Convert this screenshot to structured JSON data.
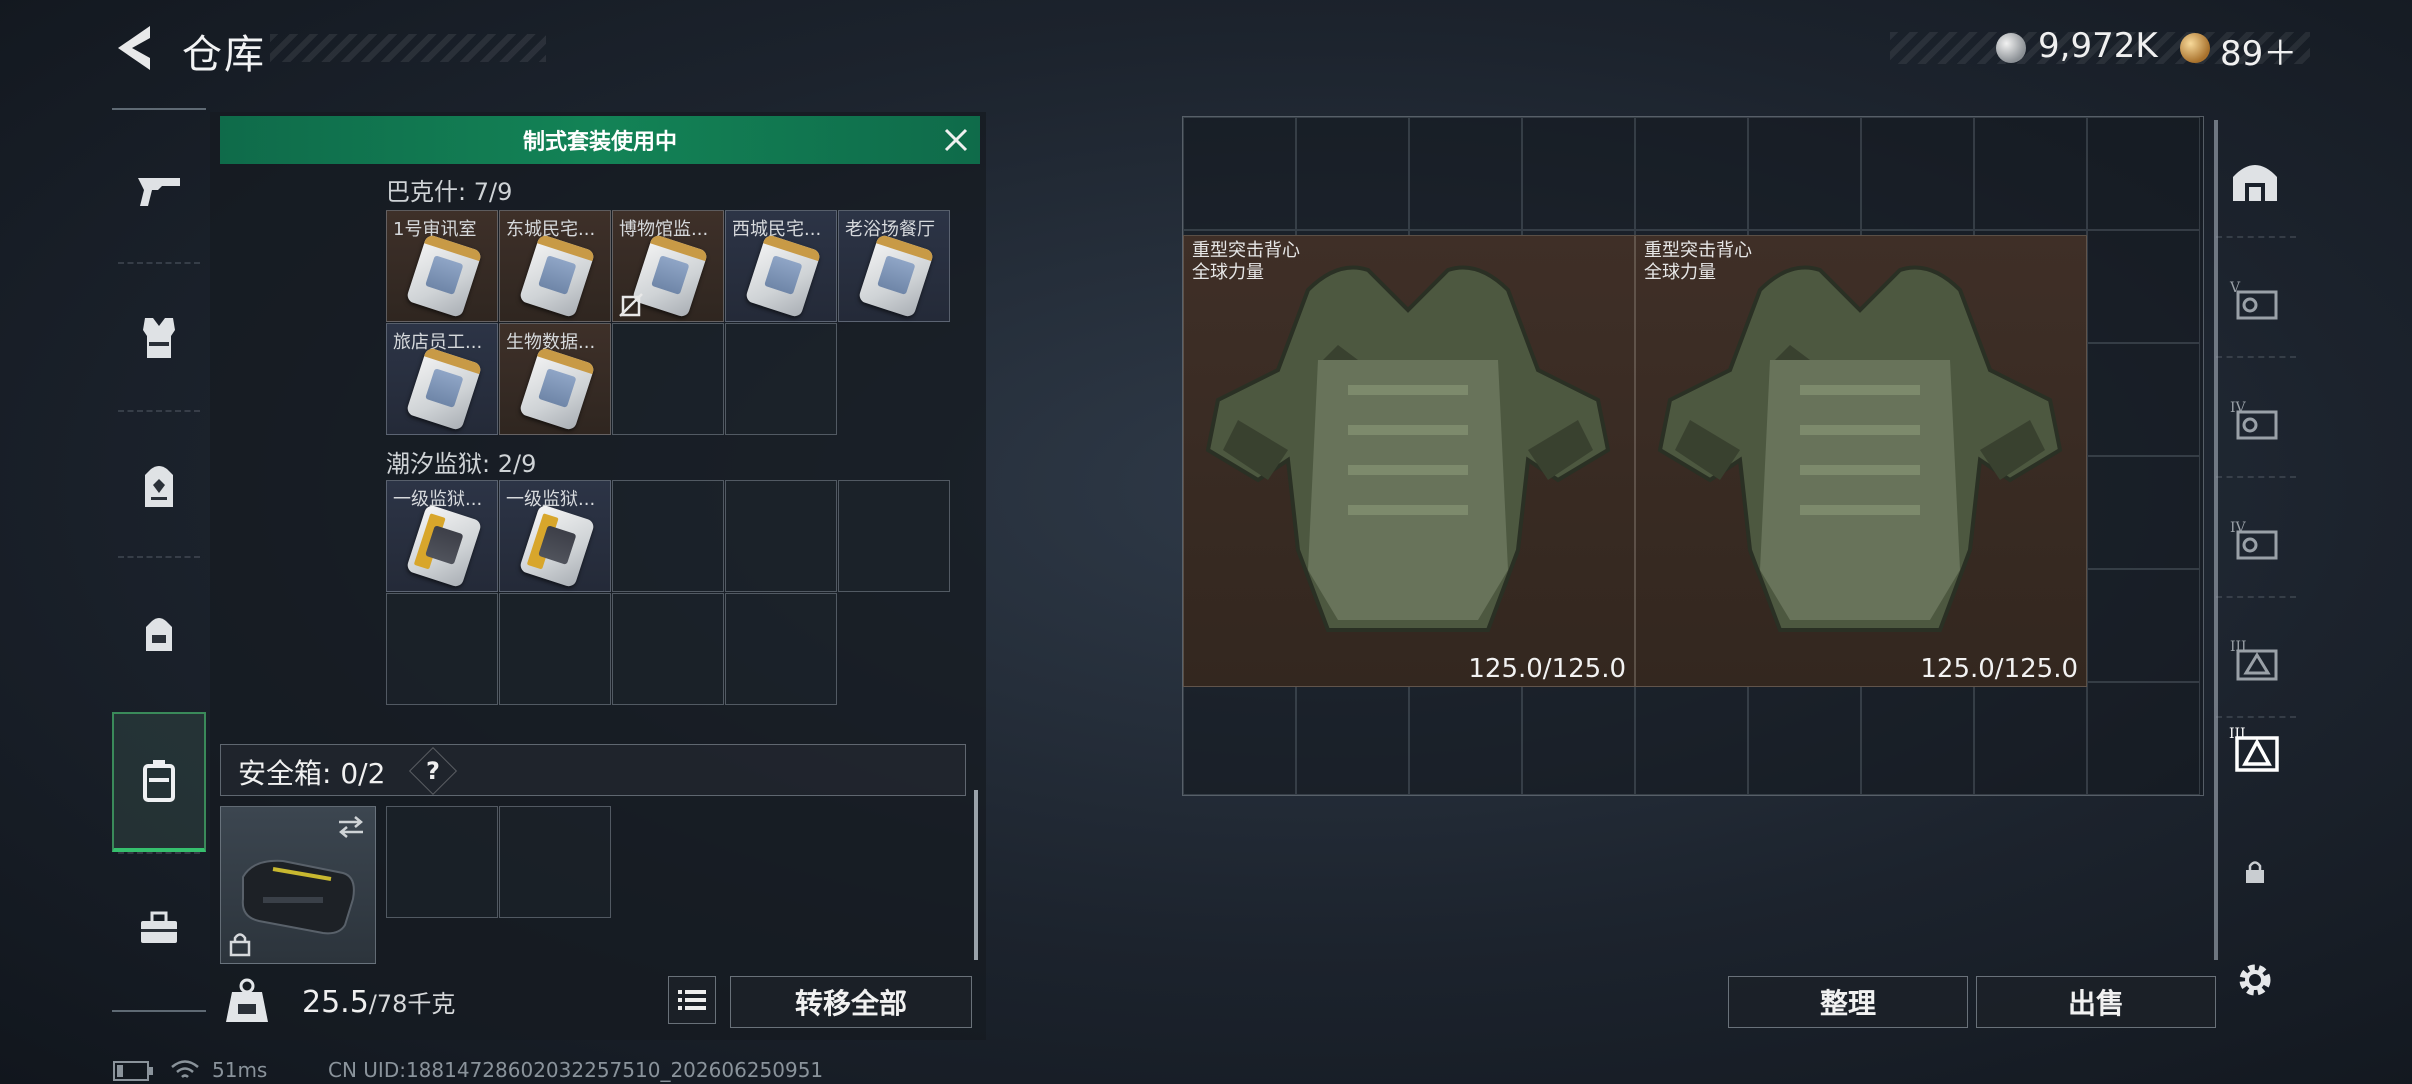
{
  "header": {
    "title": "仓库",
    "currency_silver": "9,972K",
    "currency_gold": "89＋"
  },
  "banner": {
    "text": "制式套装使用中"
  },
  "left_nav": [
    "gun-icon",
    "vest-icon",
    "backpack-icon",
    "bag-icon",
    "safebox-icon",
    "toolbox-icon"
  ],
  "sections": [
    {
      "title": "巴克什: 7/9",
      "items": [
        "1号审讯室",
        "东城民宅...",
        "博物馆监...",
        "西城民宅...",
        "老浴场餐厅",
        "旅店员工...",
        "生物数据..."
      ]
    },
    {
      "title": "潮汐监狱: 2/9",
      "items": [
        "一级监狱...",
        "一级监狱..."
      ]
    }
  ],
  "safebox": {
    "label": "安全箱:  0/2",
    "help": "?"
  },
  "weight": {
    "current": "25.5",
    "max": "/78千克"
  },
  "buttons": {
    "transfer_all": "转移全部",
    "organize": "整理",
    "sell": "出售"
  },
  "vests": [
    {
      "name": "重型突击背心",
      "sub": "全球力量",
      "durability": "125.0/125.0"
    },
    {
      "name": "重型突击背心",
      "sub": "全球力量",
      "durability": "125.0/125.0"
    }
  ],
  "status": {
    "ping": "51ms",
    "uid": "CN UID:18814728602032257510_202606250951"
  },
  "colors": {
    "accent_green": "#138356",
    "active_rail": "#36c06e"
  }
}
